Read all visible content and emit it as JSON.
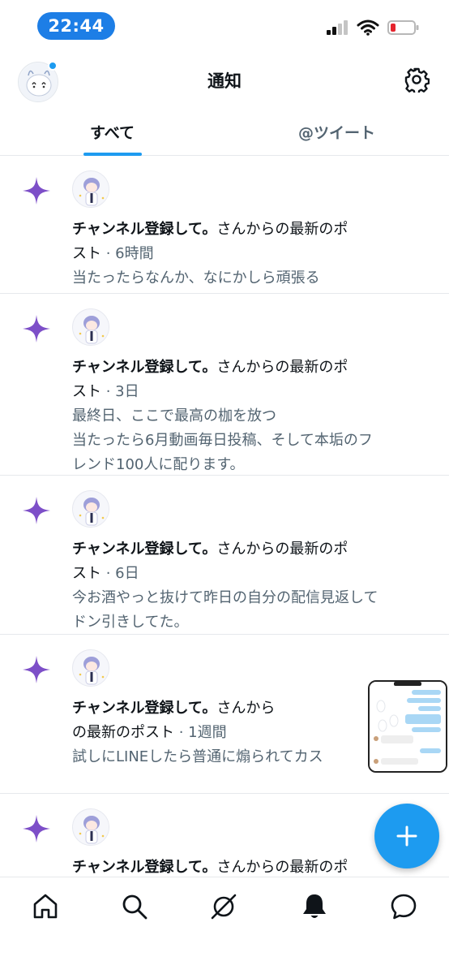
{
  "status_bar": {
    "time": "22:44",
    "icons": [
      "cellular-signal-icon",
      "wifi-icon",
      "battery-low-icon"
    ],
    "battery_color": "#e5242e"
  },
  "header": {
    "title": "通知",
    "icons": [
      "user-avatar",
      "gear-icon"
    ]
  },
  "tabs": [
    {
      "label": "すべて",
      "active": true
    },
    {
      "label": "@ツイート",
      "active": false
    }
  ],
  "colors": {
    "accent": "#1d9bf0",
    "star": "#7d4fc8",
    "secondary_text": "#536471"
  },
  "notifications": [
    {
      "icon": "sparkle-star-icon",
      "author": "チャンネル登録して。",
      "line1_rest": "さんからの最新のポ",
      "line2_start": "スト",
      "time": " · 6時間",
      "body": [
        "当たったらなんか、なにかしら頑張る"
      ]
    },
    {
      "icon": "sparkle-star-icon",
      "author": "チャンネル登録して。",
      "line1_rest": "さんからの最新のポ",
      "line2_start": "スト",
      "time": " · 3日",
      "body": [
        "最終日、ここで最高の枷を放つ",
        "当たったら6月動画毎日投稿、そして本垢のフレンド100人に配ります。"
      ]
    },
    {
      "icon": "sparkle-star-icon",
      "author": "チャンネル登録して。",
      "line1_rest": "さんからの最新のポ",
      "line2_start": "スト",
      "time": " · 6日",
      "body": [
        "今お酒やっと抜けて昨日の自分の配信見返してドン引きしてた。"
      ]
    },
    {
      "icon": "sparkle-star-icon",
      "author": "チャンネル登録して。",
      "line1_rest": "さんから",
      "line2_start": "の最新のポスト",
      "time": " · 1週間",
      "body": [
        "試しにLINEしたら普通に煽られてカス"
      ],
      "has_thumbnail": true
    },
    {
      "icon": "sparkle-star-icon",
      "author": "チャンネル登録して。",
      "line1_rest": "さんからの最新のポ",
      "line2_start": "",
      "time": "",
      "body": []
    }
  ],
  "fab": {
    "icon": "plus-icon"
  },
  "bottom_nav": [
    "home-icon",
    "search-icon",
    "spaces-icon",
    "bell-icon",
    "messages-icon"
  ]
}
